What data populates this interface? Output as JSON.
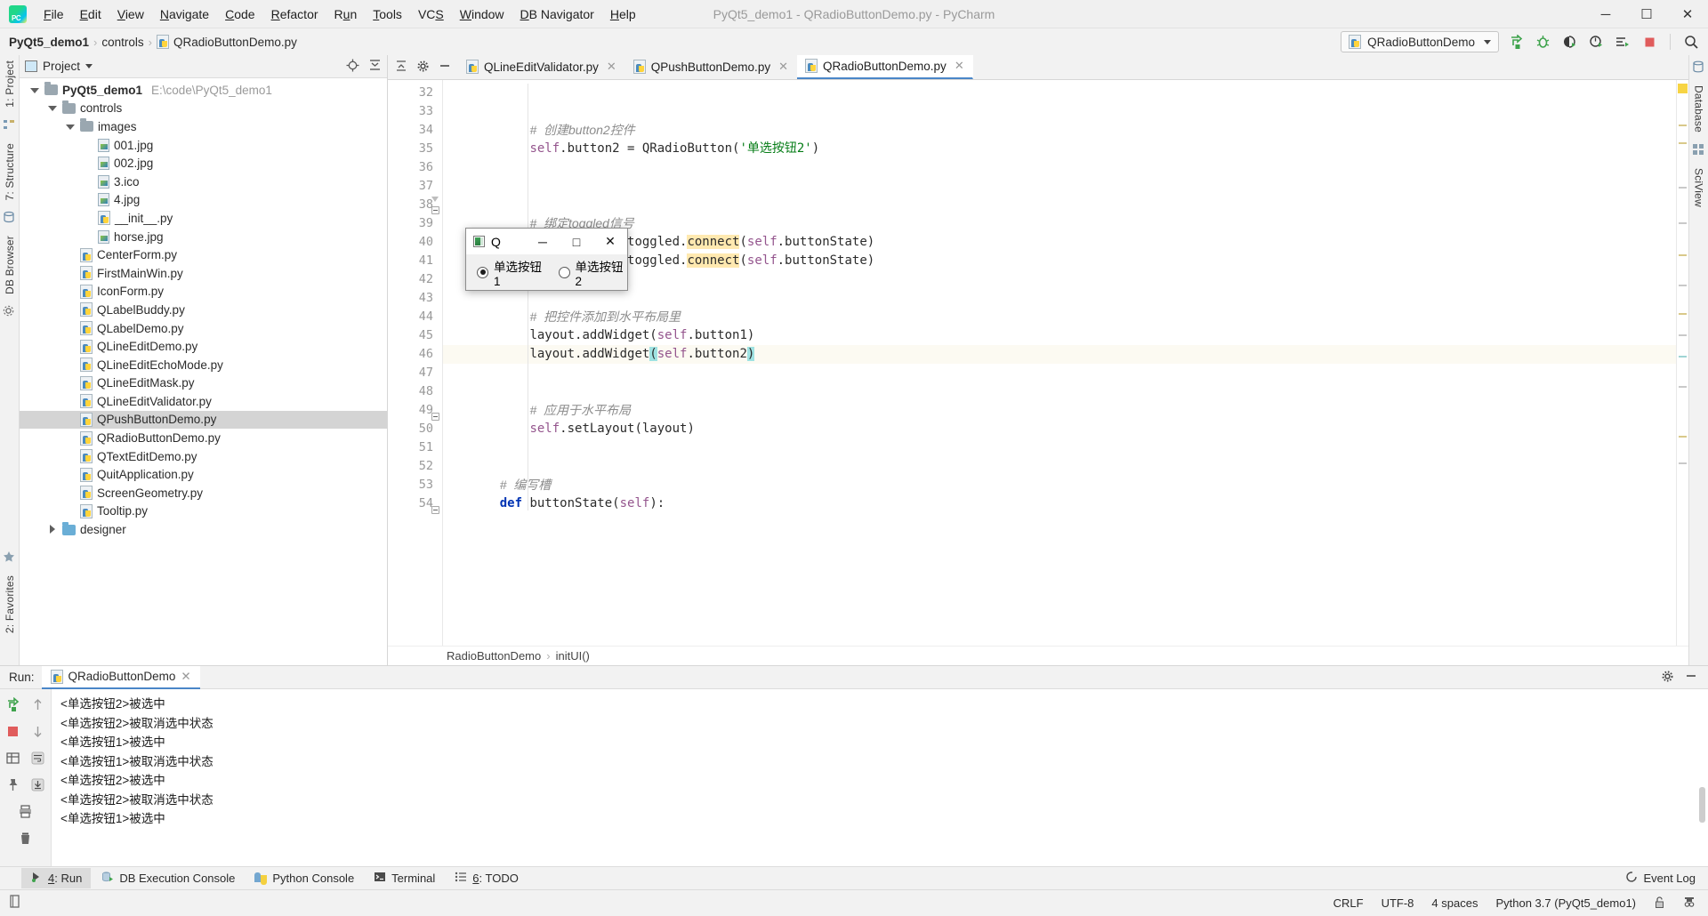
{
  "window": {
    "title": "PyQt5_demo1 - QRadioButtonDemo.py - PyCharm",
    "minimize": "─",
    "maximize": "☐",
    "close": "✕",
    "logo_text": "PC"
  },
  "menubar": {
    "items": [
      {
        "label": "File",
        "mnemonic": "F"
      },
      {
        "label": "Edit",
        "mnemonic": "E"
      },
      {
        "label": "View",
        "mnemonic": "V"
      },
      {
        "label": "Navigate",
        "mnemonic": "N"
      },
      {
        "label": "Code",
        "mnemonic": "C"
      },
      {
        "label": "Refactor",
        "mnemonic": "R"
      },
      {
        "label": "Run",
        "mnemonic": "u"
      },
      {
        "label": "Tools",
        "mnemonic": "T"
      },
      {
        "label": "VCS",
        "mnemonic": "S"
      },
      {
        "label": "Window",
        "mnemonic": "W"
      },
      {
        "label": "DB Navigator",
        "mnemonic": "D"
      },
      {
        "label": "Help",
        "mnemonic": "H"
      }
    ]
  },
  "breadcrumb": {
    "items": [
      "PyQt5_demo1",
      "controls",
      "QRadioButtonDemo.py"
    ],
    "separator": "›"
  },
  "toolbar": {
    "run_config": "QRadioButtonDemo",
    "icons": [
      {
        "name": "run-icon",
        "glyph": "▶"
      },
      {
        "name": "debug-icon",
        "glyph": "🐞"
      },
      {
        "name": "run-with-coverage-icon",
        "glyph": "◑"
      },
      {
        "name": "profile-icon",
        "glyph": "◴"
      },
      {
        "name": "run-dashboard-icon",
        "glyph": "≣"
      },
      {
        "name": "stop-icon",
        "glyph": "■"
      },
      {
        "name": "search-everywhere-icon",
        "glyph": "⚲"
      }
    ]
  },
  "left_strip": {
    "tabs": [
      "1: Project",
      "7: Structure"
    ],
    "favorites": "2: Favorites"
  },
  "right_strip": {
    "tabs": [
      "Database",
      "SciView"
    ]
  },
  "project_panel": {
    "title": "Project",
    "tree": [
      {
        "label": "PyQt5_demo1",
        "path": "E:\\code\\PyQt5_demo1",
        "depth": 0,
        "icon": "folder-icon",
        "twist": "open",
        "bold": true
      },
      {
        "label": "controls",
        "path": "",
        "depth": 1,
        "icon": "folder-icon",
        "twist": "open",
        "bold": false
      },
      {
        "label": "images",
        "path": "",
        "depth": 2,
        "icon": "folder-icon",
        "twist": "open",
        "bold": false
      },
      {
        "label": "001.jpg",
        "path": "",
        "depth": 3,
        "icon": "image-file-icon",
        "twist": "",
        "bold": false
      },
      {
        "label": "002.jpg",
        "path": "",
        "depth": 3,
        "icon": "image-file-icon",
        "twist": "",
        "bold": false
      },
      {
        "label": "3.ico",
        "path": "",
        "depth": 3,
        "icon": "image-file-icon",
        "twist": "",
        "bold": false
      },
      {
        "label": "4.jpg",
        "path": "",
        "depth": 3,
        "icon": "image-file-icon",
        "twist": "",
        "bold": false
      },
      {
        "label": "__init__.py",
        "path": "",
        "depth": 3,
        "icon": "python-file-icon",
        "twist": "",
        "bold": false
      },
      {
        "label": "horse.jpg",
        "path": "",
        "depth": 3,
        "icon": "image-file-icon",
        "twist": "",
        "bold": false
      },
      {
        "label": "CenterForm.py",
        "path": "",
        "depth": 2,
        "icon": "python-file-icon",
        "twist": "",
        "bold": false
      },
      {
        "label": "FirstMainWin.py",
        "path": "",
        "depth": 2,
        "icon": "python-file-icon",
        "twist": "",
        "bold": false
      },
      {
        "label": "IconForm.py",
        "path": "",
        "depth": 2,
        "icon": "python-file-icon",
        "twist": "",
        "bold": false
      },
      {
        "label": "QLabelBuddy.py",
        "path": "",
        "depth": 2,
        "icon": "python-file-icon",
        "twist": "",
        "bold": false
      },
      {
        "label": "QLabelDemo.py",
        "path": "",
        "depth": 2,
        "icon": "python-file-icon",
        "twist": "",
        "bold": false
      },
      {
        "label": "QLineEditDemo.py",
        "path": "",
        "depth": 2,
        "icon": "python-file-icon",
        "twist": "",
        "bold": false
      },
      {
        "label": "QLineEditEchoMode.py",
        "path": "",
        "depth": 2,
        "icon": "python-file-icon",
        "twist": "",
        "bold": false
      },
      {
        "label": "QLineEditMask.py",
        "path": "",
        "depth": 2,
        "icon": "python-file-icon",
        "twist": "",
        "bold": false
      },
      {
        "label": "QLineEditValidator.py",
        "path": "",
        "depth": 2,
        "icon": "python-file-icon",
        "twist": "",
        "bold": false
      },
      {
        "label": "QPushButtonDemo.py",
        "path": "",
        "depth": 2,
        "icon": "python-file-icon",
        "twist": "",
        "bold": false,
        "selected": true
      },
      {
        "label": "QRadioButtonDemo.py",
        "path": "",
        "depth": 2,
        "icon": "python-file-icon",
        "twist": "",
        "bold": false
      },
      {
        "label": "QTextEditDemo.py",
        "path": "",
        "depth": 2,
        "icon": "python-file-icon",
        "twist": "",
        "bold": false
      },
      {
        "label": "QuitApplication.py",
        "path": "",
        "depth": 2,
        "icon": "python-file-icon",
        "twist": "",
        "bold": false
      },
      {
        "label": "ScreenGeometry.py",
        "path": "",
        "depth": 2,
        "icon": "python-file-icon",
        "twist": "",
        "bold": false
      },
      {
        "label": "Tooltip.py",
        "path": "",
        "depth": 2,
        "icon": "python-file-icon",
        "twist": "",
        "bold": false
      },
      {
        "label": "designer",
        "path": "",
        "depth": 1,
        "icon": "folder-icon-blue",
        "twist": "closed",
        "bold": false
      }
    ]
  },
  "editor": {
    "tabs": [
      {
        "label": "QLineEditValidator.py",
        "active": false
      },
      {
        "label": "QPushButtonDemo.py",
        "active": false
      },
      {
        "label": "QRadioButtonDemo.py",
        "active": true
      }
    ],
    "close_glyph": "✕",
    "first_line": 32,
    "lines": [
      {
        "n": 32,
        "segs": []
      },
      {
        "n": 33,
        "segs": []
      },
      {
        "n": 34,
        "segs": [
          {
            "t": "        ",
            "c": "plain"
          },
          {
            "t": "#  创建button2控件",
            "c": "cmt-zh"
          }
        ]
      },
      {
        "n": 35,
        "segs": [
          {
            "t": "        ",
            "c": "plain"
          },
          {
            "t": "self",
            "c": "self"
          },
          {
            "t": ".button2 ",
            "c": "plain"
          },
          {
            "t": "= ",
            "c": "plain"
          },
          {
            "t": "QRadioButton(",
            "c": "plain"
          },
          {
            "t": "'单选按钮2'",
            "c": "str"
          },
          {
            "t": ")",
            "c": "plain"
          }
        ]
      },
      {
        "n": 36,
        "segs": []
      },
      {
        "n": 37,
        "segs": []
      },
      {
        "n": 38,
        "segs": []
      },
      {
        "n": 39,
        "segs": [
          {
            "t": "        ",
            "c": "plain"
          },
          {
            "t": "#  绑定toggled信号",
            "c": "cmt-zh"
          }
        ]
      },
      {
        "n": 40,
        "segs": [
          {
            "t": "        ",
            "c": "plain"
          },
          {
            "t": "self",
            "c": "self"
          },
          {
            "t": ".button1.toggled.",
            "c": "plain"
          },
          {
            "t": "connect",
            "c": "mark-y"
          },
          {
            "t": "(",
            "c": "plain"
          },
          {
            "t": "self",
            "c": "self"
          },
          {
            "t": ".buttonState)",
            "c": "plain"
          }
        ]
      },
      {
        "n": 41,
        "segs": [
          {
            "t": "        ",
            "c": "plain"
          },
          {
            "t": "self",
            "c": "self"
          },
          {
            "t": ".button2.toggled.",
            "c": "plain"
          },
          {
            "t": "connect",
            "c": "mark-y"
          },
          {
            "t": "(",
            "c": "plain"
          },
          {
            "t": "self",
            "c": "self"
          },
          {
            "t": ".buttonState)",
            "c": "plain"
          }
        ]
      },
      {
        "n": 42,
        "segs": []
      },
      {
        "n": 43,
        "segs": []
      },
      {
        "n": 44,
        "segs": [
          {
            "t": "        ",
            "c": "plain"
          },
          {
            "t": "#  把控件添加到水平布局里",
            "c": "cmt-zh"
          }
        ]
      },
      {
        "n": 45,
        "segs": [
          {
            "t": "        ",
            "c": "plain"
          },
          {
            "t": "layout.addWidget(",
            "c": "plain"
          },
          {
            "t": "self",
            "c": "self"
          },
          {
            "t": ".button1)",
            "c": "plain"
          }
        ]
      },
      {
        "n": 46,
        "segs": [
          {
            "t": "        ",
            "c": "plain"
          },
          {
            "t": "layout.addWidget",
            "c": "plain"
          },
          {
            "t": "(",
            "c": "mark-c"
          },
          {
            "t": "self",
            "c": "self"
          },
          {
            "t": ".button2",
            "c": "plain"
          },
          {
            "t": ")",
            "c": "mark-c"
          }
        ],
        "highlight": true
      },
      {
        "n": 47,
        "segs": []
      },
      {
        "n": 48,
        "segs": []
      },
      {
        "n": 49,
        "segs": [
          {
            "t": "        ",
            "c": "plain"
          },
          {
            "t": "#  应用于水平布局",
            "c": "cmt-zh"
          }
        ]
      },
      {
        "n": 50,
        "segs": [
          {
            "t": "        ",
            "c": "plain"
          },
          {
            "t": "self",
            "c": "self"
          },
          {
            "t": ".setLayout(layout)",
            "c": "plain"
          }
        ]
      },
      {
        "n": 51,
        "segs": []
      },
      {
        "n": 52,
        "segs": []
      },
      {
        "n": 53,
        "segs": [
          {
            "t": "    ",
            "c": "plain"
          },
          {
            "t": "#  编写槽",
            "c": "cmt-zh"
          }
        ]
      },
      {
        "n": 54,
        "segs": [
          {
            "t": "    ",
            "c": "plain"
          },
          {
            "t": "def ",
            "c": "kw"
          },
          {
            "t": "buttonState(",
            "c": "plain"
          },
          {
            "t": "self",
            "c": "self"
          },
          {
            "t": "):",
            "c": "plain"
          }
        ]
      }
    ],
    "breadcrumb_bottom": [
      "RadioButtonDemo",
      "initUI()"
    ]
  },
  "qt_dialog": {
    "title": "Q",
    "minimize": "─",
    "maximize": "□",
    "close": "✕",
    "radio1": "单选按钮1",
    "radio2": "单选按钮2",
    "radio1_checked": true,
    "radio2_checked": false
  },
  "run_panel": {
    "label": "Run:",
    "tab": "QRadioButtonDemo",
    "close_glyph": "✕",
    "output": [
      "<单选按钮2>被选中",
      "<单选按钮2>被取消选中状态",
      "<单选按钮1>被选中",
      "<单选按钮1>被取消选中状态",
      "<单选按钮2>被选中",
      "<单选按钮2>被取消选中状态",
      "<单选按钮1>被选中"
    ],
    "tools": [
      "rerun-icon",
      "up-icon",
      "down-icon",
      "soft-wrap-icon",
      "scroll-to-end-icon",
      "grid-icon",
      "pin-icon",
      "print-icon",
      "trash-icon"
    ]
  },
  "toolwindow_bar": {
    "items": [
      {
        "label": "4: Run",
        "mnemonic": "4",
        "icon": "run-icon",
        "active": true
      },
      {
        "label": "DB Execution Console",
        "mnemonic": "",
        "icon": "db-icon",
        "active": false
      },
      {
        "label": "Python Console",
        "mnemonic": "",
        "icon": "python-icon",
        "active": false
      },
      {
        "label": "Terminal",
        "mnemonic": "",
        "icon": "terminal-icon",
        "active": false
      },
      {
        "label": "6: TODO",
        "mnemonic": "6",
        "icon": "todo-icon",
        "active": false
      }
    ],
    "event_log": "Event Log"
  },
  "statusbar": {
    "line_sep": "CRLF",
    "encoding": "UTF-8",
    "indent": "4 spaces",
    "interpreter": "Python 3.7 (PyQt5_demo1)",
    "lock_icon": "🔓",
    "inspector_icon": "🕵"
  },
  "colors": {
    "accent": "#4a86c8",
    "run_green": "#3fa34d",
    "stop_red": "#e05c5c",
    "selection": "#d4d4d4",
    "highlight_yellow": "#ffe9b0",
    "highlight_cyan": "#9fe2e2"
  }
}
